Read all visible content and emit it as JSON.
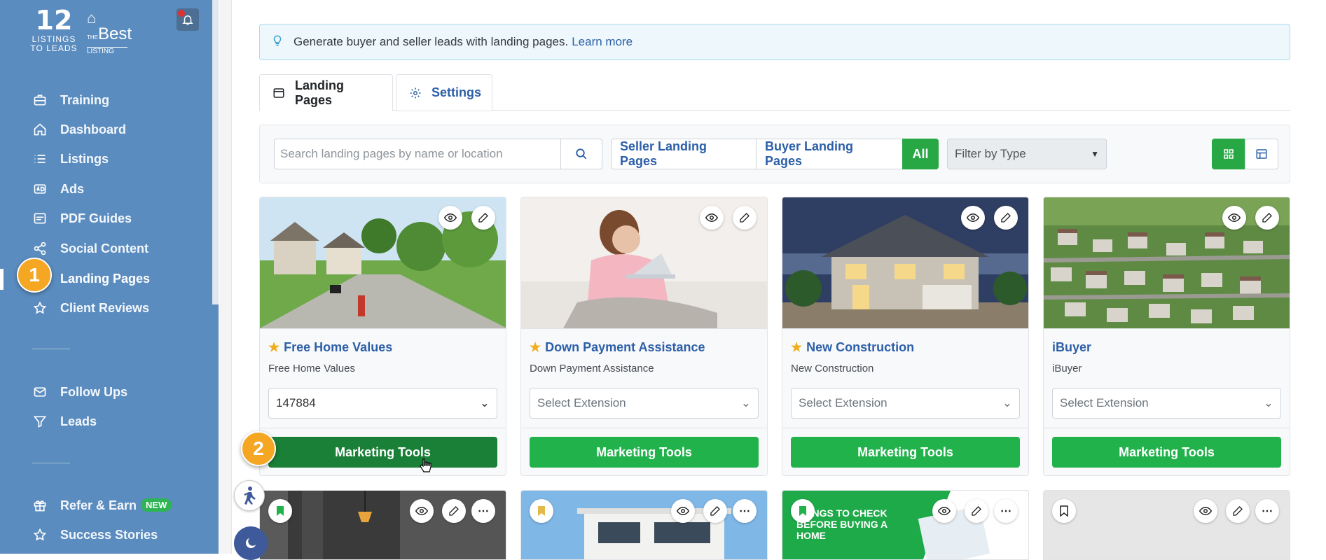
{
  "sidebar": {
    "logo1": {
      "mark": "12",
      "line1": "LISTINGS",
      "line2": "TO LEADS"
    },
    "logo2": {
      "small": "THE",
      "big": "Best",
      "line": "LISTING"
    },
    "items": [
      {
        "label": "Training",
        "icon": "briefcase-icon"
      },
      {
        "label": "Dashboard",
        "icon": "home-icon"
      },
      {
        "label": "Listings",
        "icon": "list-icon"
      },
      {
        "label": "Ads",
        "icon": "ad-icon"
      },
      {
        "label": "PDF Guides",
        "icon": "pdf-icon"
      },
      {
        "label": "Social Content",
        "icon": "share-icon"
      },
      {
        "label": "Landing Pages",
        "icon": "landing-icon",
        "active": true
      },
      {
        "label": "Client Reviews",
        "icon": "star-icon"
      }
    ],
    "items2": [
      {
        "label": "Follow Ups",
        "icon": "mail-icon"
      },
      {
        "label": "Leads",
        "icon": "filter-icon"
      }
    ],
    "items3": [
      {
        "label": "Refer & Earn",
        "icon": "gift-icon",
        "badge": "NEW"
      },
      {
        "label": "Success Stories",
        "icon": "star-icon"
      }
    ],
    "step1": "1"
  },
  "info": {
    "text": "Generate buyer and seller leads with landing pages.",
    "link": "Learn more"
  },
  "tabs": [
    {
      "label": "Landing Pages"
    },
    {
      "label": "Settings"
    }
  ],
  "filters": {
    "search_placeholder": "Search landing pages by name or location",
    "seg1": "Seller Landing Pages",
    "seg2": "Buyer Landing Pages",
    "seg3": "All",
    "type_placeholder": "Filter by Type"
  },
  "cards": [
    {
      "title": "Free Home Values",
      "subtitle": "Free Home Values",
      "select": "147884",
      "button": "Marketing Tools"
    },
    {
      "title": "Down Payment Assistance",
      "subtitle": "Down Payment Assistance",
      "select": "Select Extension",
      "button": "Marketing Tools"
    },
    {
      "title": "New Construction",
      "subtitle": "New Construction",
      "select": "Select Extension",
      "button": "Marketing Tools"
    },
    {
      "title": "iBuyer",
      "subtitle": "iBuyer",
      "select": "Select Extension",
      "button": "Marketing Tools"
    }
  ],
  "card2_text": "THINGS TO CHECK BEFORE BUYING A HOME",
  "step2": "2",
  "colors": {
    "sidebar": "#5b8cbf",
    "accent_green": "#22b24c",
    "link_blue": "#2c5fa8",
    "badge_orange": "#f5a623"
  }
}
